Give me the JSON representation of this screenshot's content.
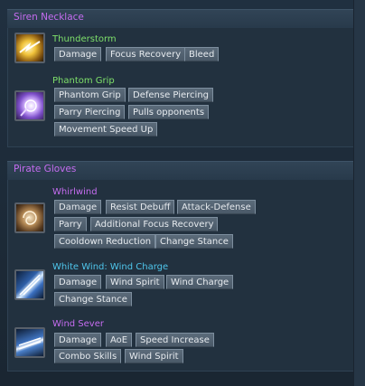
{
  "sections": [
    {
      "title": "Siren Necklace",
      "skills": [
        {
          "name": "Thunderstorm",
          "name_color": "#7ee06a",
          "icon": "thunderstorm-icon",
          "tags": [
            "Damage",
            "Focus Recovery",
            "Bleed"
          ]
        },
        {
          "name": "Phantom Grip",
          "name_color": "#7ee06a",
          "icon": "phantom-grip-icon",
          "tags": [
            "Phantom Grip",
            "Defense Piercing",
            "Parry Piercing",
            "Pulls opponents",
            "Movement Speed Up"
          ]
        }
      ]
    },
    {
      "title": "Pirate Gloves",
      "skills": [
        {
          "name": "Whirlwind",
          "name_color": "#c56cf0",
          "icon": "whirlwind-icon",
          "tags": [
            "Damage",
            "Resist Debuff",
            "Attack-Defense",
            "Parry",
            "Additional Focus Recovery",
            "Cooldown Reduction",
            "Change Stance"
          ]
        },
        {
          "name": "White Wind: Wind Charge",
          "name_color": "#4fc6ec",
          "icon": "wind-charge-icon",
          "tags": [
            "Damage",
            "Wind Spirit",
            "Wind Charge",
            "Change Stance"
          ]
        },
        {
          "name": "Wind Sever",
          "name_color": "#c56cf0",
          "icon": "wind-sever-icon",
          "tags": [
            "Damage",
            "AoE",
            "Speed Increase",
            "Combo Skills",
            "Wind Spirit"
          ]
        }
      ]
    }
  ],
  "colors": {
    "header_text": "#c56cf0",
    "panel_bg": "#22313f",
    "tag_bg": "#52616f"
  }
}
